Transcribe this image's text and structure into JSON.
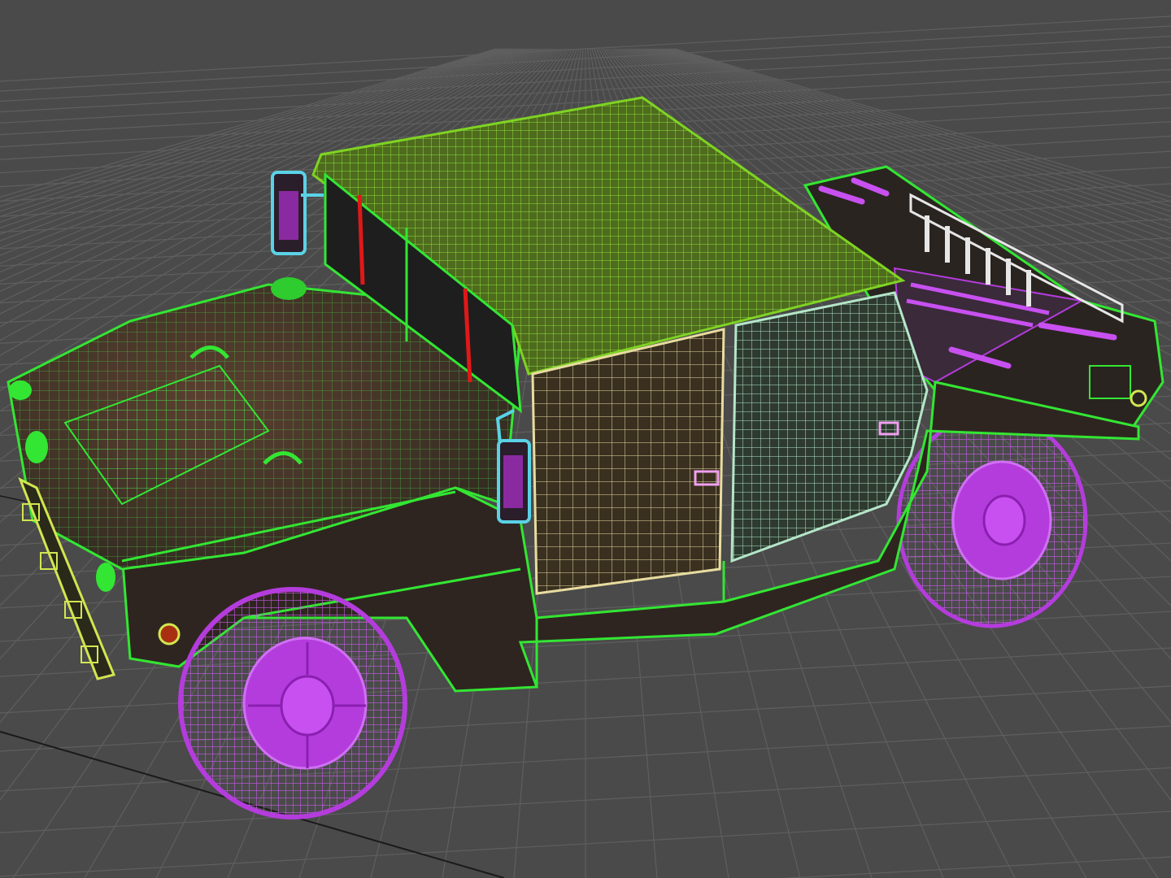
{
  "scene": {
    "background_color": "#4a4a4a",
    "grid_color": "#5f5f5f",
    "axis_color": "#1a1a1a",
    "object_colors": {
      "body": "#33e633",
      "roof": "#7ed321",
      "body_fill": "#3a2c22",
      "wheels": "#b43cdc",
      "wheel_hub": "#c850f0",
      "mirrors": "#5ad2e6",
      "door_front": "#e8dca0",
      "door_rear": "#b4e6c8",
      "glass": "#1e1e1e",
      "wipers": "#e01818",
      "bed_rail": "#e6e6e6",
      "lights": "#d2e650"
    },
    "objects": [
      {
        "name": "humvee-body",
        "icon": "vehicle-wireframe"
      },
      {
        "name": "roof-canopy",
        "icon": "mesh"
      },
      {
        "name": "front-wheel",
        "icon": "wheel"
      },
      {
        "name": "rear-wheel",
        "icon": "wheel"
      },
      {
        "name": "front-door",
        "icon": "mesh"
      },
      {
        "name": "rear-door",
        "icon": "mesh"
      },
      {
        "name": "side-mirror",
        "icon": "mesh"
      },
      {
        "name": "cargo-bed",
        "icon": "mesh"
      }
    ]
  }
}
